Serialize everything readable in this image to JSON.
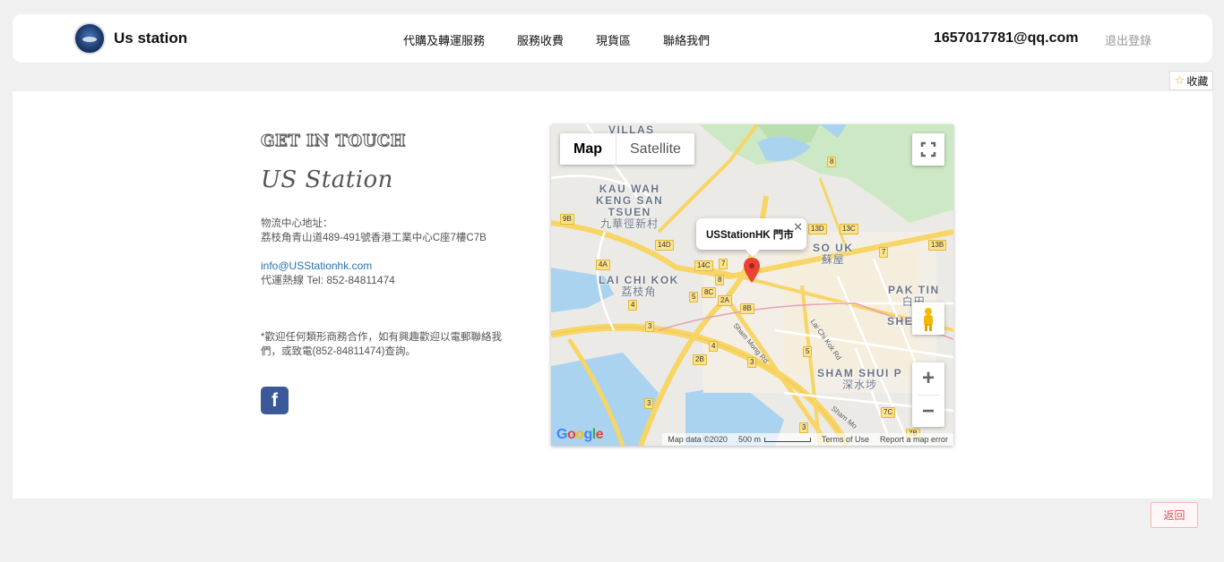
{
  "header": {
    "brand": "Us station",
    "nav": [
      "代購及轉運服務",
      "服務收費",
      "現貨區",
      "聯絡我們"
    ],
    "user_email": "1657017781@qq.com",
    "logout": "退出登錄",
    "favorite": "收藏"
  },
  "contact": {
    "heading": "GET IN TOUCH",
    "script_title": "US Station",
    "address_label": "物流中心地址：",
    "address": "荔枝角青山道489-491號香港工業中心C座7樓C7B",
    "email": "info@USStationhk.com",
    "hotline": "代運熱線 Tel: 852-84811474",
    "note": "*歡迎任何類形商務合作，如有興趣歡迎以電郵聯絡我們，或致電(852-84811474)查詢。",
    "facebook_icon": "facebook-icon"
  },
  "map": {
    "type_map": "Map",
    "type_satellite": "Satellite",
    "info_title": "USStationHK 門市",
    "close": "✕",
    "zoom_in": "+",
    "zoom_out": "−",
    "google": "Google",
    "map_data": "Map data ©2020",
    "scale": "500 m",
    "terms": "Terms of Use",
    "report": "Report a map error",
    "areas": {
      "villas": "VILLAS",
      "kau_wah_1": "KAU WAH",
      "kau_wah_2": "KENG SAN",
      "kau_wah_3": "TSUEN",
      "kau_wah_zh": "九華徑新村",
      "so_uk": "SO UK",
      "so_uk_zh": "蘇屋",
      "lai_chi_kok": "LAI CHI KOK",
      "lai_chi_kok_zh": "荔枝角",
      "pak_tin": "PAK TIN",
      "pak_tin_zh": "白田",
      "shek": "SHE",
      "sham_shui_po": "SHAM SHUI P",
      "sham_shui_po_zh": "深水埗"
    },
    "roads": {
      "sham_mong": "Sham Mong Rd",
      "lai_chi_kok_rd": "Lai Chi Kok Rd",
      "sham_mong_2": "Sham Mo"
    },
    "shields": [
      "8",
      "9B",
      "14D",
      "13D",
      "13C",
      "13B",
      "4A",
      "14C",
      "7",
      "7",
      "8",
      "8C",
      "5",
      "2A",
      "8B",
      "4",
      "3",
      "4",
      "2B",
      "3",
      "5",
      "3",
      "7C",
      "3",
      "7B"
    ]
  },
  "back_button": "返回"
}
